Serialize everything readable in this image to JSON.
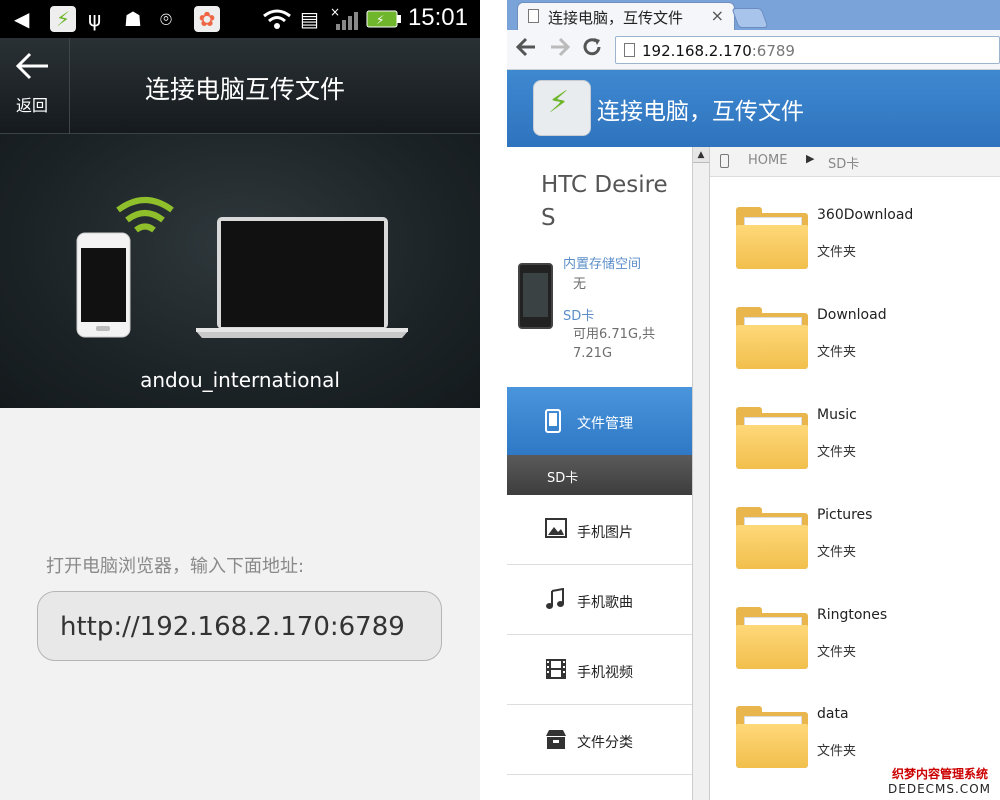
{
  "phone": {
    "status_time": "15:01",
    "back_label": "返回",
    "title": "连接电脑互传文件",
    "device_name": "andou_international",
    "instruction": "打开电脑浏览器，输入下面地址:",
    "url": "http://192.168.2.170:6789",
    "accent_color": "#8fbf2b"
  },
  "browser": {
    "tab_title": "连接电脑，互传文件",
    "tab_close": "×",
    "address_host": "192.168.2.170",
    "address_port": ":6789",
    "app_title": "连接电脑，互传文件"
  },
  "sidebar": {
    "device_title": "HTC Desire S",
    "internal_label": "内置存储空间",
    "internal_value": "无",
    "sd_label": "SD卡",
    "sd_value": "可用6.71G,共7.21G",
    "nav_active": "文件管理",
    "nav_sub": "SD卡",
    "nav_items": [
      {
        "label": "手机图片",
        "icon": "image-icon"
      },
      {
        "label": "手机歌曲",
        "icon": "music-icon"
      },
      {
        "label": "手机视频",
        "icon": "film-icon"
      },
      {
        "label": "文件分类",
        "icon": "box-icon"
      }
    ]
  },
  "breadcrumb": {
    "home": "HOME",
    "current": "SD卡"
  },
  "folders": [
    {
      "name": "360Download",
      "type": "文件夹"
    },
    {
      "name": "Download",
      "type": "文件夹"
    },
    {
      "name": "Music",
      "type": "文件夹"
    },
    {
      "name": "Pictures",
      "type": "文件夹"
    },
    {
      "name": "Ringtones",
      "type": "文件夹"
    },
    {
      "name": "data",
      "type": "文件夹"
    }
  ],
  "watermark": {
    "line1": "织梦内容管理系统",
    "line2": "DEDECMS.COM"
  }
}
